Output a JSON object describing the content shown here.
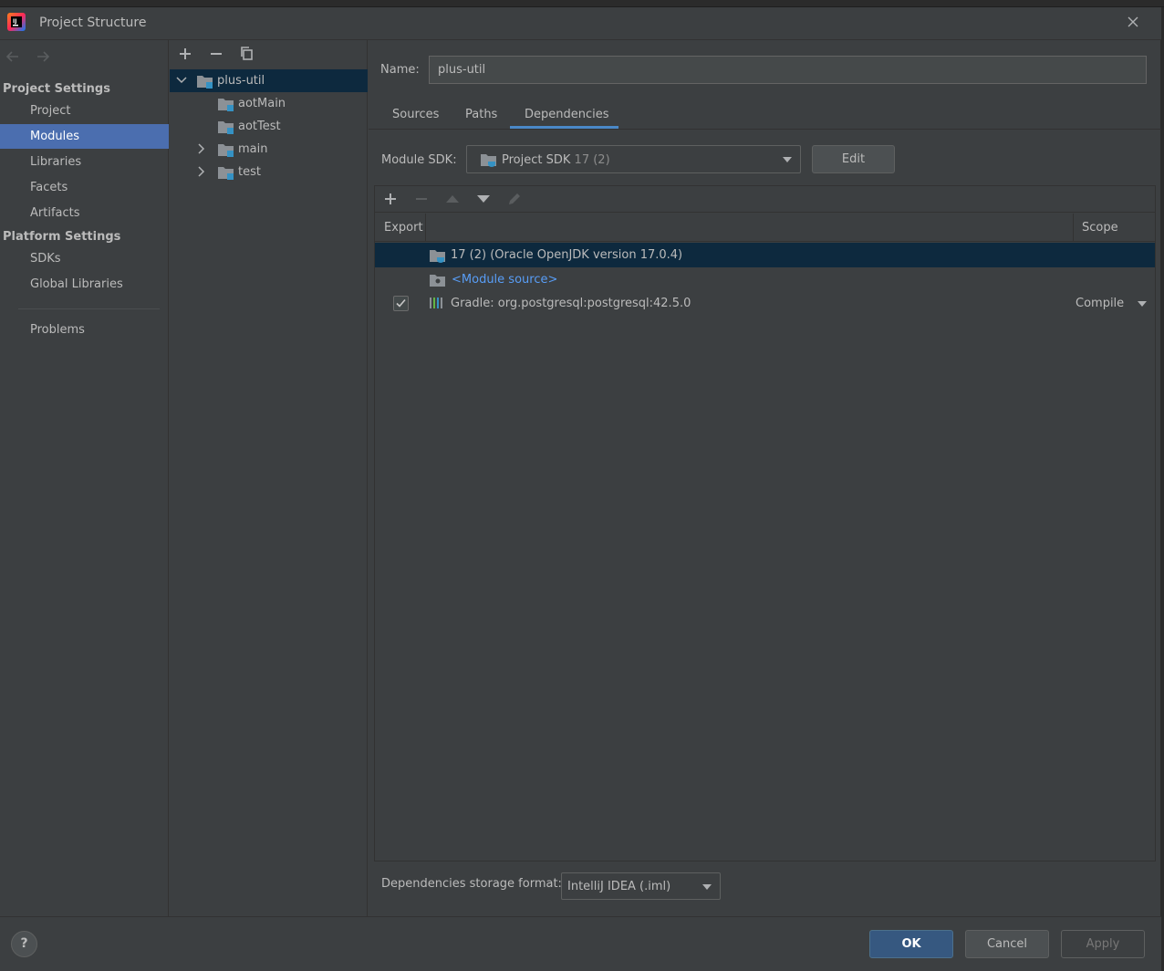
{
  "window": {
    "title": "Project Structure",
    "icons": {
      "app": "intellij-logo-icon",
      "close": "close-icon"
    }
  },
  "nav": {
    "back_icon": "arrow-left-icon",
    "forward_icon": "arrow-right-icon",
    "project_settings_header": "Project Settings",
    "project_settings_items": [
      {
        "label": "Project",
        "selected": false
      },
      {
        "label": "Modules",
        "selected": true
      },
      {
        "label": "Libraries",
        "selected": false
      },
      {
        "label": "Facets",
        "selected": false
      },
      {
        "label": "Artifacts",
        "selected": false
      }
    ],
    "platform_settings_header": "Platform Settings",
    "platform_settings_items": [
      {
        "label": "SDKs"
      },
      {
        "label": "Global Libraries"
      }
    ],
    "problems_label": "Problems"
  },
  "tree": {
    "toolbar_icons": [
      "add-icon",
      "remove-icon",
      "copy-icon"
    ],
    "root": {
      "label": "plus-util",
      "expanded": true
    },
    "children": [
      {
        "label": "aotMain",
        "expandable": false
      },
      {
        "label": "aotTest",
        "expandable": false
      },
      {
        "label": "main",
        "expandable": true
      },
      {
        "label": "test",
        "expandable": true
      }
    ]
  },
  "module": {
    "name_label": "Name:",
    "name_value": "plus-util",
    "tabs": [
      {
        "label": "Sources",
        "active": false
      },
      {
        "label": "Paths",
        "active": false
      },
      {
        "label": "Dependencies",
        "active": true
      }
    ],
    "sdk_label": "Module SDK:",
    "sdk_value": "Project SDK",
    "sdk_version": "17 (2)",
    "edit_label": "Edit",
    "dep_toolbar_icons": [
      "add-icon",
      "remove-icon",
      "move-up-icon",
      "move-down-icon",
      "edit-pencil-icon"
    ],
    "columns": {
      "export": "Export",
      "scope": "Scope"
    },
    "dependencies": [
      {
        "name": "17 (2) (Oracle OpenJDK version 17.0.4)",
        "export": null,
        "scope": "",
        "icon": "jdk-folder-icon",
        "selected": true
      },
      {
        "name": "<Module source>",
        "export": null,
        "scope": "",
        "icon": "module-source-folder-icon",
        "selected": false
      },
      {
        "name": "Gradle: org.postgresql:postgresql:42.5.0",
        "export": true,
        "scope": "Compile",
        "icon": "library-icon",
        "selected": false
      }
    ],
    "storage_label": "Dependencies storage format:",
    "storage_value": "IntelliJ IDEA (.iml)"
  },
  "buttons": {
    "help": "?",
    "ok": "OK",
    "cancel": "Cancel",
    "apply": "Apply"
  },
  "colors": {
    "background": "#3c3f41",
    "selection": "#4b6eaf",
    "tree_selection": "#0d293e",
    "accent": "#4a88c7",
    "link": "#589df6",
    "ok_button": "#365880"
  }
}
